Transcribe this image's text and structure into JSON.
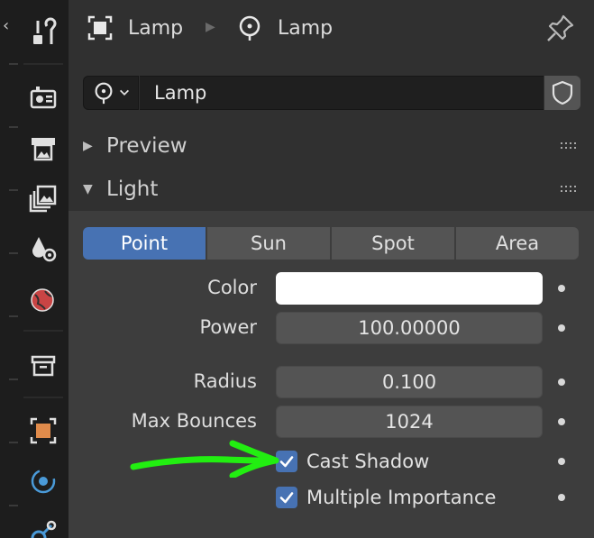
{
  "breadcrumb": {
    "object_name": "Lamp",
    "data_name": "Lamp"
  },
  "datablock": {
    "name": "Lamp"
  },
  "panels": {
    "preview_title": "Preview",
    "light_title": "Light"
  },
  "light_types": {
    "options": [
      "Point",
      "Sun",
      "Spot",
      "Area"
    ],
    "selected": "Point"
  },
  "properties": {
    "color_label": "Color",
    "color_value": "#ffffff",
    "power_label": "Power",
    "power_value": "100.00000",
    "radius_label": "Radius",
    "radius_value": "0.100",
    "max_bounces_label": "Max Bounces",
    "max_bounces_value": "1024",
    "cast_shadow_label": "Cast Shadow",
    "cast_shadow_checked": true,
    "multiple_importance_label": "Multiple Importance",
    "multiple_importance_checked": true
  },
  "annotation": {
    "arrow_color": "#22ee11"
  },
  "colors": {
    "accent": "#4772b3",
    "panel_bg": "#303030",
    "subpanel_bg": "#3d3d3d",
    "field_bg": "#545454"
  },
  "icons": {
    "tabs": [
      "tool-icon",
      "render-icon",
      "output-icon",
      "view-layer-icon",
      "scene-icon",
      "world-icon",
      "collection-icon",
      "object-icon",
      "physics-icon",
      "constraints-icon"
    ]
  }
}
